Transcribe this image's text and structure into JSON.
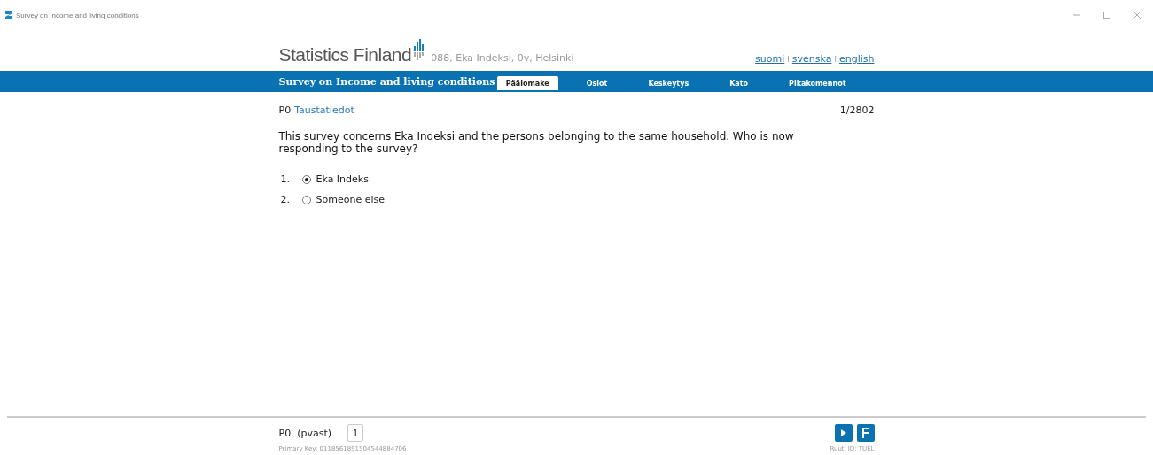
{
  "window": {
    "title": "Survey on Income and living conditions"
  },
  "header": {
    "logo_text": "Statistics Finland",
    "respondent": "088, Eka Indeksi, 0v, Helsinki",
    "languages": [
      {
        "label": "suomi",
        "separator": "l"
      },
      {
        "label": "svenska",
        "separator": "l"
      },
      {
        "label": "english"
      }
    ]
  },
  "nav": {
    "title": "Survey on Income and living conditions",
    "tabs": [
      {
        "label": "Päälomake",
        "selected": true
      },
      {
        "label": "Osiot",
        "selected": false
      },
      {
        "label": "Keskeytys",
        "selected": false
      },
      {
        "label": "Kato",
        "selected": false
      },
      {
        "label": "Pikakomennot",
        "selected": false
      }
    ]
  },
  "question": {
    "code": "P0",
    "section": "Taustatiedot",
    "counter": "1/2802",
    "text": "This survey concerns Eka Indeksi and the persons belonging to the same household. Who is now responding to the survey?",
    "options": [
      {
        "number": "1.",
        "label": "Eka Indeksi",
        "selected": true
      },
      {
        "number": "2.",
        "label": "Someone else",
        "selected": false
      }
    ]
  },
  "footer": {
    "variable": "P0  (pvast)",
    "answer_value": "1",
    "primary_key": "Primary Key: 0118561891504544884706",
    "ruuti_id": "Ruuti ID: TUEL"
  }
}
